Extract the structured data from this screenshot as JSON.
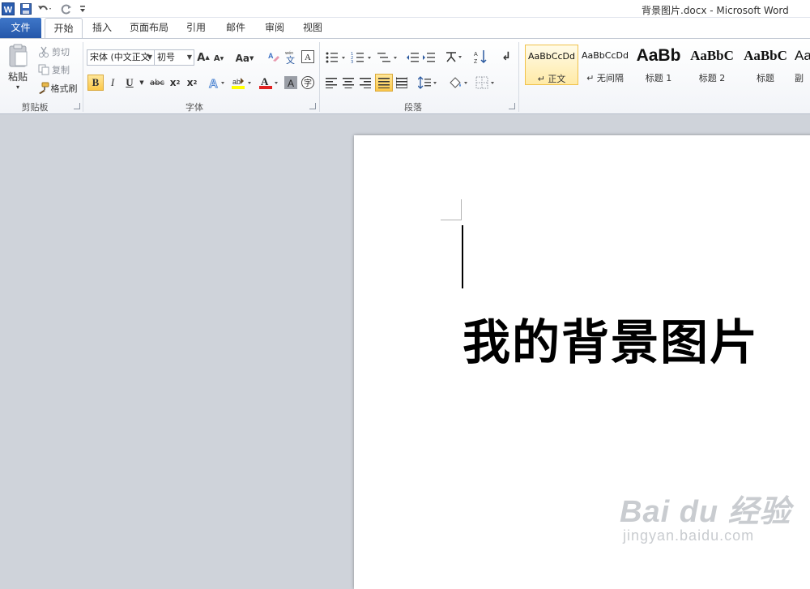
{
  "app": {
    "title": "背景图片.docx - Microsoft Word"
  },
  "tabs": [
    "文件",
    "开始",
    "插入",
    "页面布局",
    "引用",
    "邮件",
    "审阅",
    "视图"
  ],
  "clipboard": {
    "paste": "粘贴",
    "cut": "剪切",
    "copy": "复制",
    "format_painter": "格式刷",
    "group_label": "剪贴板"
  },
  "font": {
    "name": "宋体 (中文正文",
    "size": "初号",
    "case_button": "Aa",
    "group_label": "字体"
  },
  "paragraph": {
    "group_label": "段落"
  },
  "styles": [
    {
      "sample": "AaBbCcDd",
      "name": "↵ 正文",
      "selected": true
    },
    {
      "sample": "AaBbCcDd",
      "name": "↵ 无间隔",
      "selected": false
    },
    {
      "sample": "AaBb",
      "name": "标题 1",
      "selected": false
    },
    {
      "sample": "AaBbC",
      "name": "标题 2",
      "selected": false
    },
    {
      "sample": "AaBbC",
      "name": "标题",
      "selected": false
    },
    {
      "sample": "Aa",
      "name": "副",
      "selected": false
    }
  ],
  "document": {
    "heading": "我的背景图片"
  },
  "watermark": {
    "logo": "Bai du 经验",
    "url": "jingyan.baidu.com"
  },
  "colors": {
    "file_tab": "#2b5eb0",
    "highlight": "#ffff00",
    "font_color": "#e02020",
    "selected_style": "#ffe9a3"
  }
}
